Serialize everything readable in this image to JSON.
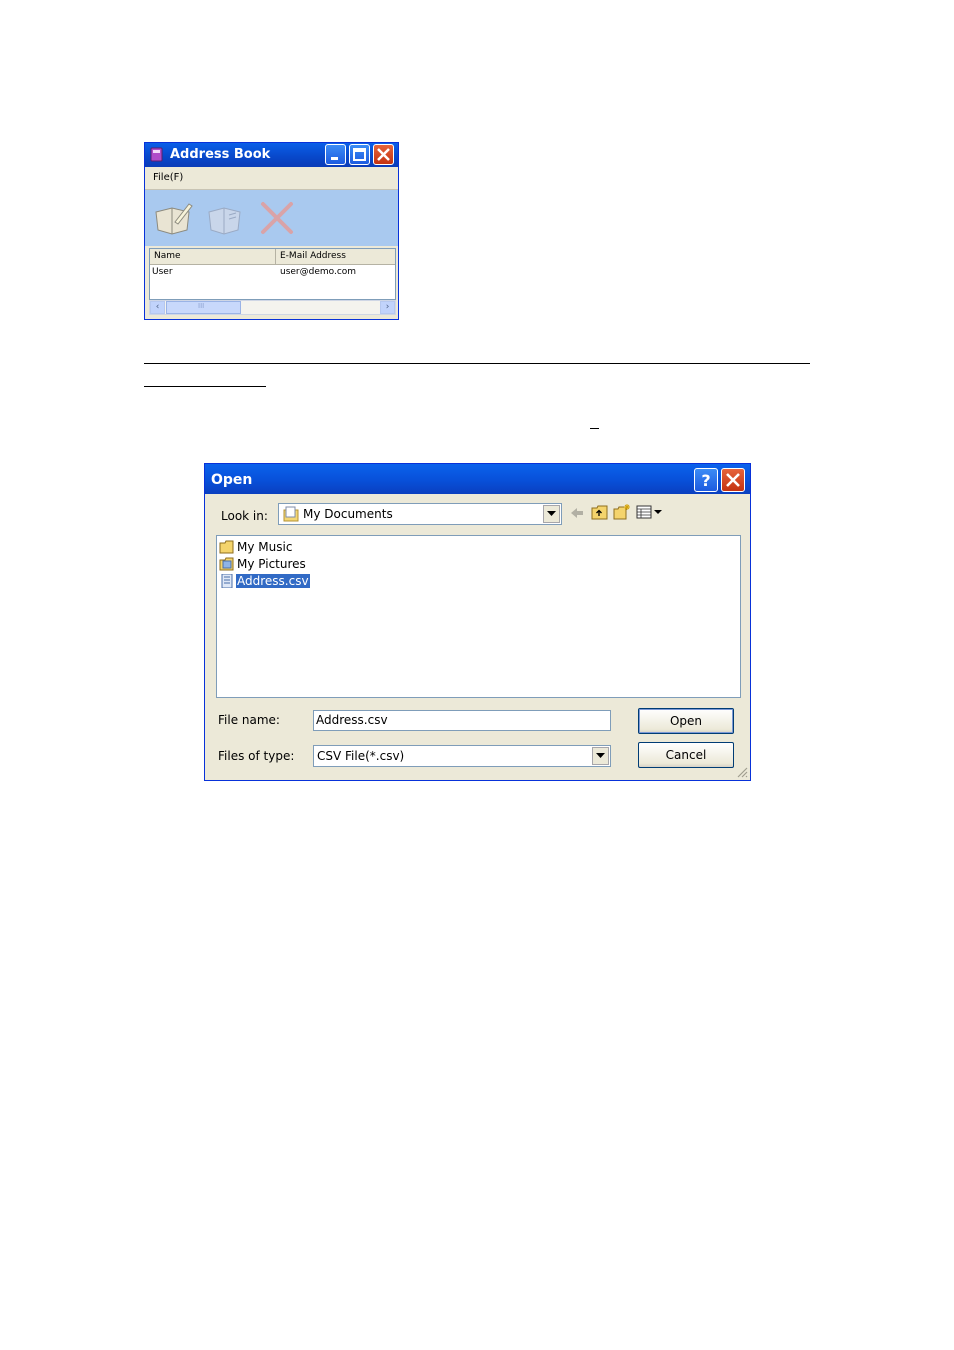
{
  "address_book": {
    "title": "Address Book",
    "menu": {
      "file": "File(F)"
    },
    "columns": [
      "Name",
      "E-Mail Address"
    ],
    "rows": [
      {
        "name": "User",
        "email": "user@demo.com"
      }
    ],
    "scroll_thumb": "III"
  },
  "open_dialog": {
    "title": "Open",
    "help_icon": "question-mark",
    "look_in_label": "Look in:",
    "look_in_value": "My Documents",
    "files": [
      {
        "name": "My Music",
        "icon": "folder-icon",
        "selected": false
      },
      {
        "name": "My Pictures",
        "icon": "pictures-folder-icon",
        "selected": false
      },
      {
        "name": "Address.csv",
        "icon": "csv-file-icon",
        "selected": true
      }
    ],
    "file_name_label": "File name:",
    "file_name_value": "Address.csv",
    "file_type_label": "Files of type:",
    "file_type_value": "CSV File(*.csv)",
    "open_button": "Open",
    "cancel_button": "Cancel"
  },
  "colors": {
    "titlebar_blue": "#0a5fe8",
    "selection": "#316ac5",
    "toolbar_bg": "#a9c9ef",
    "dialog_bg": "#ece9d8"
  }
}
